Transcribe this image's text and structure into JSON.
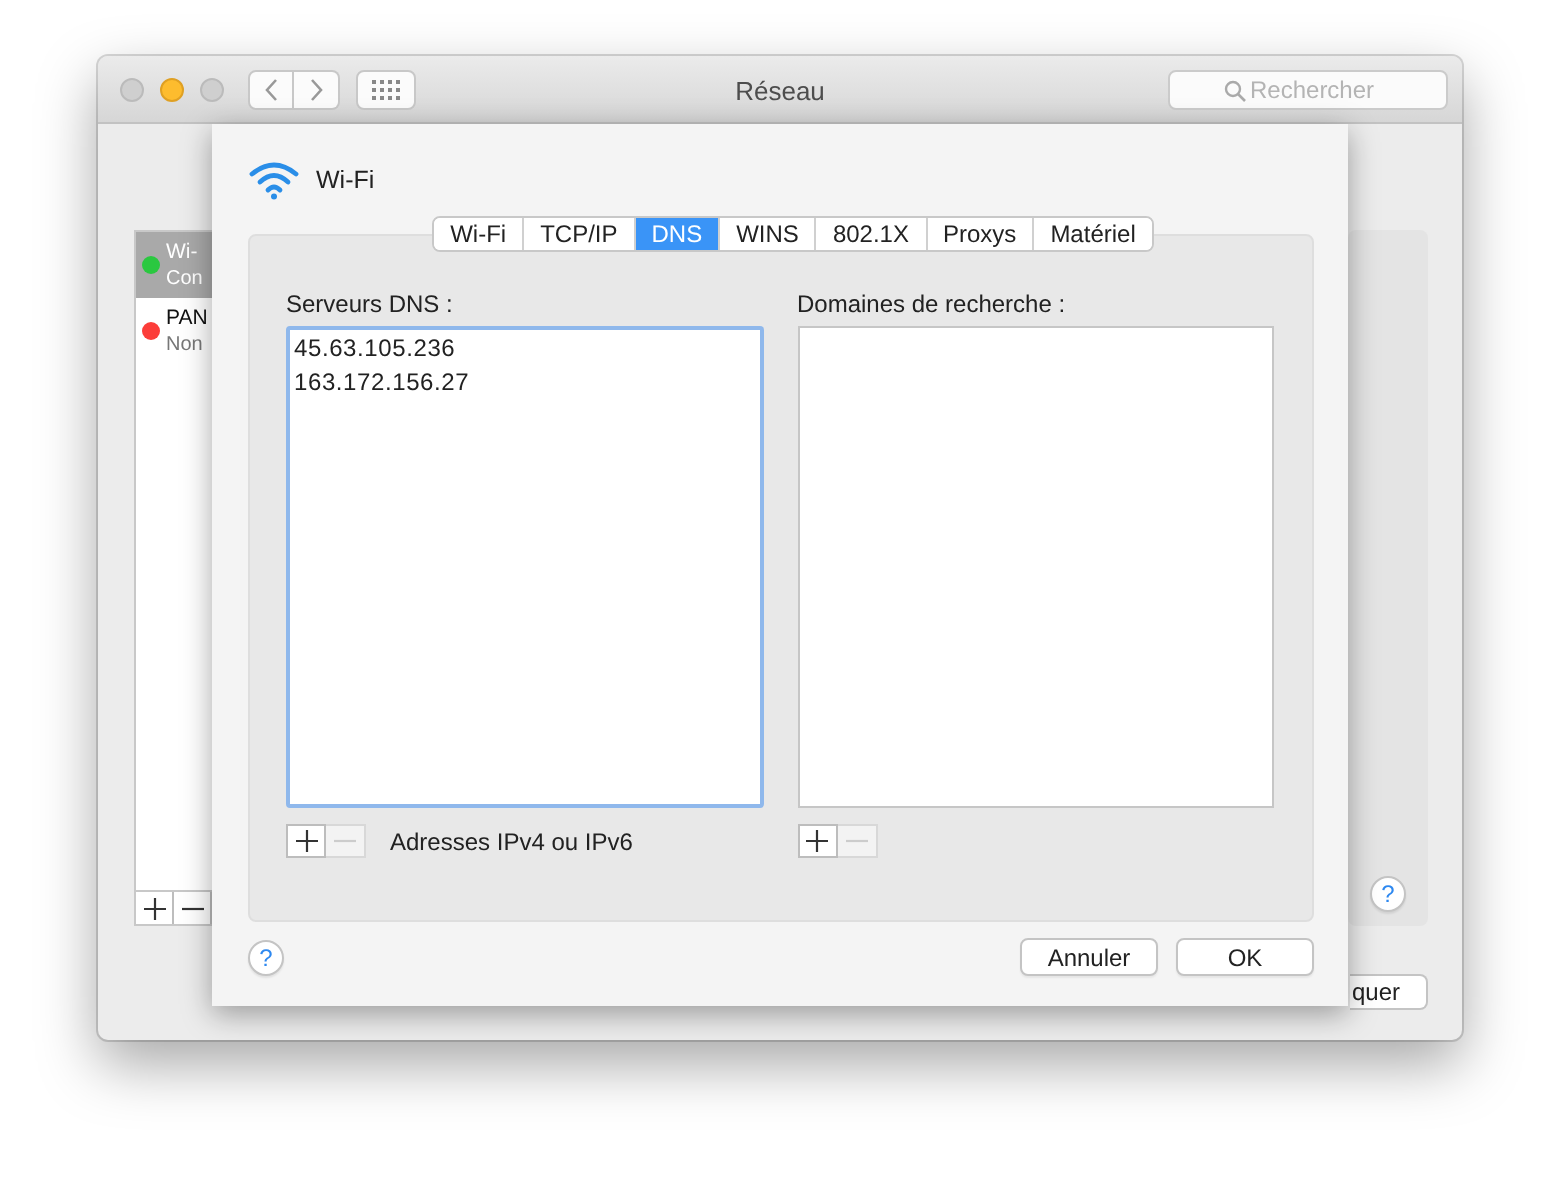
{
  "window": {
    "title": "Réseau",
    "search_placeholder": "Rechercher"
  },
  "services": [
    {
      "name": "Wi-",
      "status": "Con",
      "color": "#2ac840",
      "selected": true
    },
    {
      "name": "PAN",
      "status": "Non",
      "color": "#fc3d39",
      "selected": false
    }
  ],
  "background_help": "?",
  "background_button": "quer",
  "sheet": {
    "title": "Wi-Fi",
    "tabs": [
      {
        "label": "Wi-Fi",
        "selected": false
      },
      {
        "label": "TCP/IP",
        "selected": false
      },
      {
        "label": "DNS",
        "selected": true
      },
      {
        "label": "WINS",
        "selected": false
      },
      {
        "label": "802.1X",
        "selected": false
      },
      {
        "label": "Proxys",
        "selected": false
      },
      {
        "label": "Matériel",
        "selected": false
      }
    ],
    "lists": [
      {
        "label": "Serveurs DNS :",
        "focused": true,
        "entries": [
          "45.63.105.236",
          "163.172.156.27"
        ],
        "remove_disabled": true,
        "hint": "Adresses IPv4 ou IPv6"
      },
      {
        "label": "Domaines de recherche :",
        "focused": false,
        "remove_disabled": true
      }
    ],
    "help": "?",
    "buttons": [
      "Annuler",
      "OK"
    ]
  }
}
